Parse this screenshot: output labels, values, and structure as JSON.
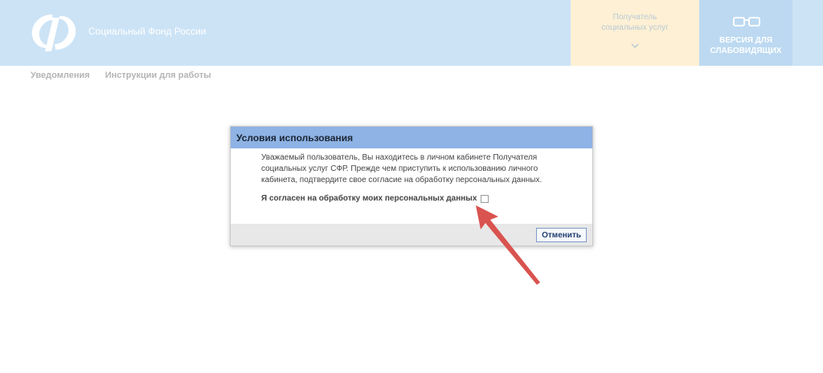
{
  "header": {
    "site_title": "Социальный Фонд России",
    "recipient_label_line1": "Получатель",
    "recipient_label_line2": "социальных услуг",
    "low_vision_line1": "ВЕРСИЯ ДЛЯ",
    "low_vision_line2": "СЛАБОВИДЯЩИХ"
  },
  "nav": {
    "items": [
      "Уведомления",
      "Инструкции для работы"
    ]
  },
  "dialog": {
    "title": "Условия использования",
    "body": "Уважаемый пользователь, Вы находитесь в личном кабинете Получателя социальных услуг СФР. Прежде чем приступить к использованию личного кабинета, подтвердите свое согласие на обработку персональных данных.",
    "consent_label": "Я согласен на обработку моих персональных данных",
    "consent_checked": false,
    "cancel_label": "Отменить"
  },
  "colors": {
    "header_bg": "#cce3f6",
    "recipient_bg": "#fdf0d4",
    "low_vision_bg": "#bcd9f1",
    "dialog_header_bg": "#8eb3e4",
    "annotation_arrow": "#d9534f"
  },
  "icons": {
    "logo": "sfr-logo-icon",
    "recipient_dropdown": "chevron-down-icon",
    "low_vision": "glasses-icon",
    "annotation": "red-arrow-icon"
  }
}
